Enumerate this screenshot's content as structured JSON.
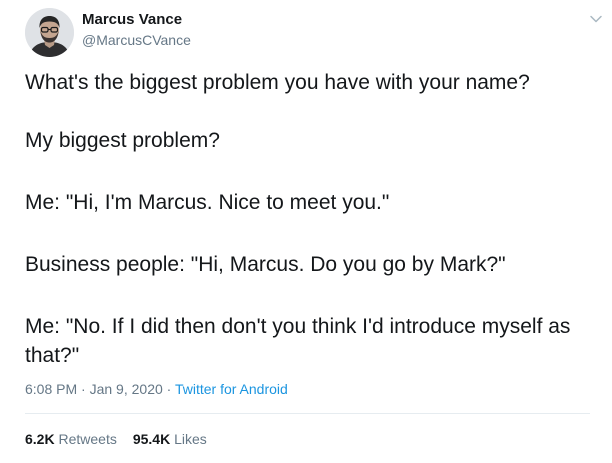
{
  "author": {
    "name": "Marcus Vance",
    "handle": "@MarcusCVance"
  },
  "menu": {
    "icon": "chevron-down-icon",
    "color": "#aab8c2"
  },
  "tweet": {
    "paragraphs": [
      "What's the biggest problem you have with your name?",
      "My biggest problem?",
      "Me: \"Hi, I'm Marcus. Nice to meet you.\"",
      "Business people: \"Hi, Marcus. Do you go by Mark?\"",
      "Me: \"No. If I did then don't you think I'd introduce myself as that?\""
    ]
  },
  "meta": {
    "time": "6:08 PM",
    "separator1": " · ",
    "date": "Jan 9, 2020",
    "separator2": " · ",
    "source": "Twitter for Android"
  },
  "stats": {
    "retweets_count": "6.2K",
    "retweets_label": "Retweets",
    "likes_count": "95.4K",
    "likes_label": "Likes"
  },
  "colors": {
    "text": "#14171a",
    "secondary": "#657786",
    "link": "#1b95e0",
    "divider": "#e6ecf0"
  }
}
